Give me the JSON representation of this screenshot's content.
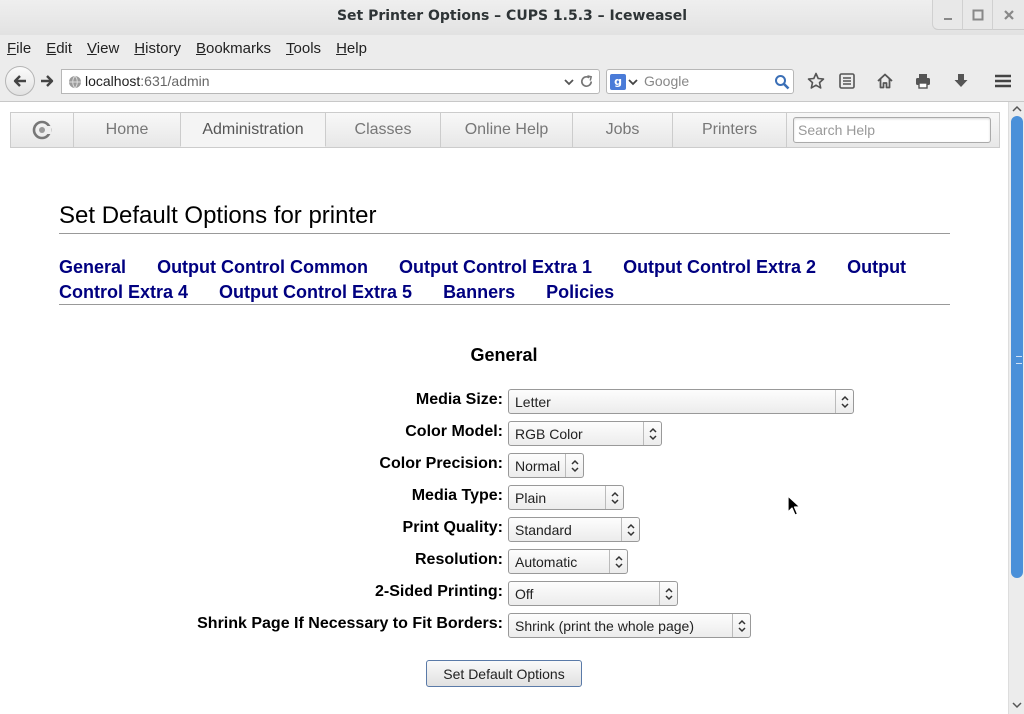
{
  "window": {
    "title": "Set Printer Options – CUPS 1.5.3 – Iceweasel"
  },
  "menu": {
    "items": [
      {
        "label": "File",
        "accel": "F",
        "rest": "ile"
      },
      {
        "label": "Edit",
        "accel": "E",
        "rest": "dit"
      },
      {
        "label": "View",
        "accel": "V",
        "rest": "iew"
      },
      {
        "label": "History",
        "accel": "H",
        "rest": "istory"
      },
      {
        "label": "Bookmarks",
        "accel": "B",
        "rest": "ookmarks"
      },
      {
        "label": "Tools",
        "accel": "T",
        "rest": "ools"
      },
      {
        "label": "Help",
        "accel": "H",
        "rest": "elp"
      }
    ]
  },
  "toolbar": {
    "url_host": "localhost",
    "url_rest": ":631/admin",
    "search_placeholder": "Google",
    "search_engine_letter": "g"
  },
  "cups_nav": {
    "tabs": [
      {
        "label": "Home",
        "active": false
      },
      {
        "label": "Administration",
        "active": true
      },
      {
        "label": "Classes",
        "active": false
      },
      {
        "label": "Online Help",
        "active": false
      },
      {
        "label": "Jobs",
        "active": false
      },
      {
        "label": "Printers",
        "active": false
      }
    ],
    "search_placeholder": "Search Help"
  },
  "page": {
    "heading": "Set Default Options for printer",
    "section_links": [
      "General",
      "Output Control Common",
      "Output Control Extra 1",
      "Output Control Extra 2",
      "Output Control Extra 4",
      "Output Control Extra 5",
      "Banners",
      "Policies"
    ],
    "section_title": "General",
    "options": [
      {
        "label": "Media Size:",
        "value": "Letter"
      },
      {
        "label": "Color Model:",
        "value": "RGB Color"
      },
      {
        "label": "Color Precision:",
        "value": "Normal"
      },
      {
        "label": "Media Type:",
        "value": "Plain"
      },
      {
        "label": "Print Quality:",
        "value": "Standard"
      },
      {
        "label": "Resolution:",
        "value": "Automatic"
      },
      {
        "label": "2-Sided Printing:",
        "value": "Off"
      },
      {
        "label": "Shrink Page If Necessary to Fit Borders:",
        "value": "Shrink (print the whole page)"
      }
    ],
    "submit_label": "Set Default Options"
  },
  "colors": {
    "link": "#000080",
    "scroll_thumb": "#4a90d9"
  }
}
